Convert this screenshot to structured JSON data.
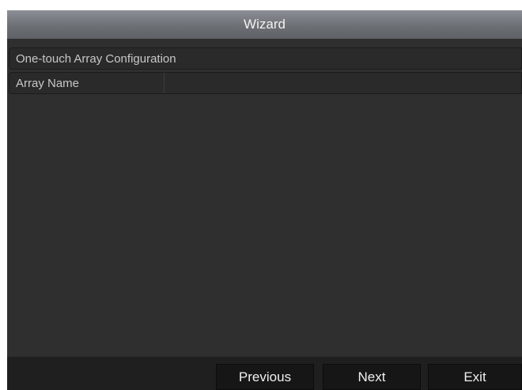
{
  "window": {
    "title": "Wizard"
  },
  "section": {
    "heading": "One-touch Array Configuration"
  },
  "fields": {
    "array_name": {
      "label": "Array Name",
      "value": ""
    }
  },
  "footer": {
    "previous_label": "Previous",
    "next_label": "Next",
    "exit_label": "Exit"
  },
  "colors": {
    "background": "#2f2f2f",
    "titlebar": "#6c7075",
    "text": "#c8c8c8",
    "button": "#161616"
  }
}
